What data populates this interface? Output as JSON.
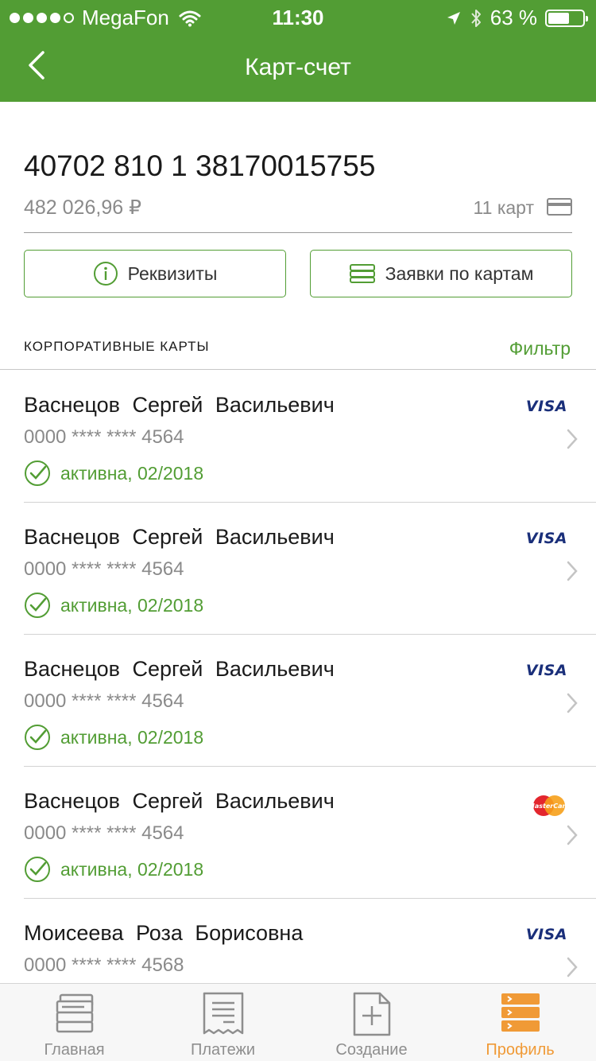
{
  "status_bar": {
    "carrier": "MegaFon",
    "time": "11:30",
    "battery": "63 %",
    "battery_level": 0.63
  },
  "header": {
    "title": "Карт-счет"
  },
  "account": {
    "number": "40702 810 1 38170015755",
    "balance": "482 026,96 ₽",
    "cards_count": "11 карт"
  },
  "actions": {
    "requisites_label": "Реквизиты",
    "card_requests_label": "Заявки по картам"
  },
  "section": {
    "title": "КОРПОРАТИВНЫЕ КАРТЫ",
    "filter_label": "Фильтр"
  },
  "cards": [
    {
      "holder": "Васнецов Сергей Васильевич",
      "number": "0000 **** **** 4564",
      "status": "активна, 02/2018",
      "brand": "VISA"
    },
    {
      "holder": "Васнецов Сергей Васильевич",
      "number": "0000 **** **** 4564",
      "status": "активна, 02/2018",
      "brand": "VISA"
    },
    {
      "holder": "Васнецов Сергей Васильевич",
      "number": "0000 **** **** 4564",
      "status": "активна, 02/2018",
      "brand": "VISA"
    },
    {
      "holder": "Васнецов Сергей Васильевич",
      "number": "0000 **** **** 4564",
      "status": "активна, 02/2018",
      "brand": "MasterCard"
    },
    {
      "holder": "Моисеева Роза Борисовна",
      "number": "0000 **** **** 4568",
      "status": "",
      "brand": "VISA"
    }
  ],
  "tabs": [
    {
      "label": "Главная",
      "icon": "home-cards-icon",
      "active": false
    },
    {
      "label": "Платежи",
      "icon": "receipt-icon",
      "active": false
    },
    {
      "label": "Создание",
      "icon": "create-document-icon",
      "active": false
    },
    {
      "label": "Профиль",
      "icon": "profile-server-icon",
      "active": true
    }
  ],
  "colors": {
    "brand_green": "#529d34",
    "active_tab": "#f09a36",
    "muted_text": "#8a8a8a"
  }
}
